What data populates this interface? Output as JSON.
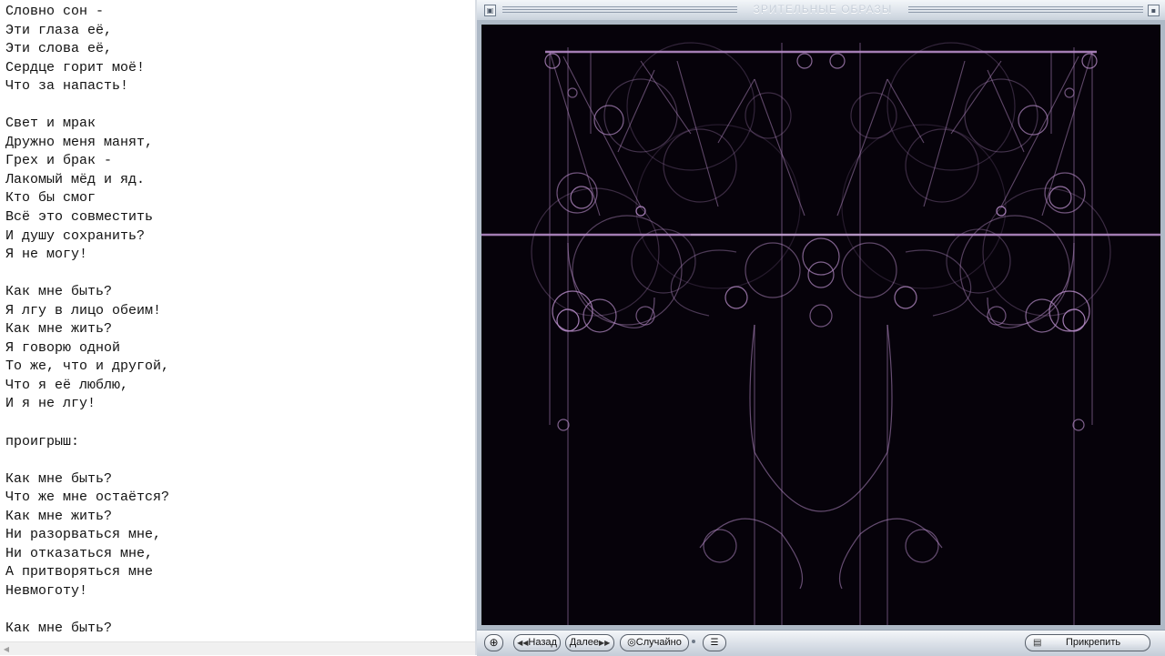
{
  "editor": {
    "lines": [
      "Словно сон -",
      "Эти глаза её,",
      "Эти слова её,",
      "Сердце горит моё!",
      "Что за напасть!",
      "",
      "Свет и мрак",
      "Дружно меня манят,",
      "Грех и брак -",
      "Лакомый мёд и яд.",
      "Кто бы смог",
      "Всё это совместить",
      "И душу сохранить?",
      "Я не могу!",
      "",
      "Как мне быть?",
      "Я лгу в лицо обеим!",
      "Как мне жить?",
      "Я говорю одной",
      "То же, что и другой,",
      "Что я её люблю,",
      "И я не лгу!",
      "",
      "проигрыш:",
      "",
      "Как мне быть?",
      "Что же мне остаётся?",
      "Как мне жить?",
      "Ни разорваться мне,",
      "Ни отказаться мне,",
      "А притворяться мне",
      "Невмоготу!",
      "",
      "Как мне быть?"
    ]
  },
  "player": {
    "title": "ЗРИТЕЛЬНЫЕ ОБРАЗЫ",
    "controls": {
      "move_icon": "⊕",
      "back_icon": "◀◀",
      "back_label": "Назад",
      "next_label": "Далее",
      "next_icon": "▶▶",
      "random_icon": "◎",
      "random_label": "Случайно",
      "menu_icon": "☰",
      "dock_icon": "▤",
      "dock_label": "Прикрепить"
    },
    "visualization": {
      "background": "#06020a",
      "line_color": "#b58bc6",
      "glow_color": "#ffffff"
    }
  }
}
